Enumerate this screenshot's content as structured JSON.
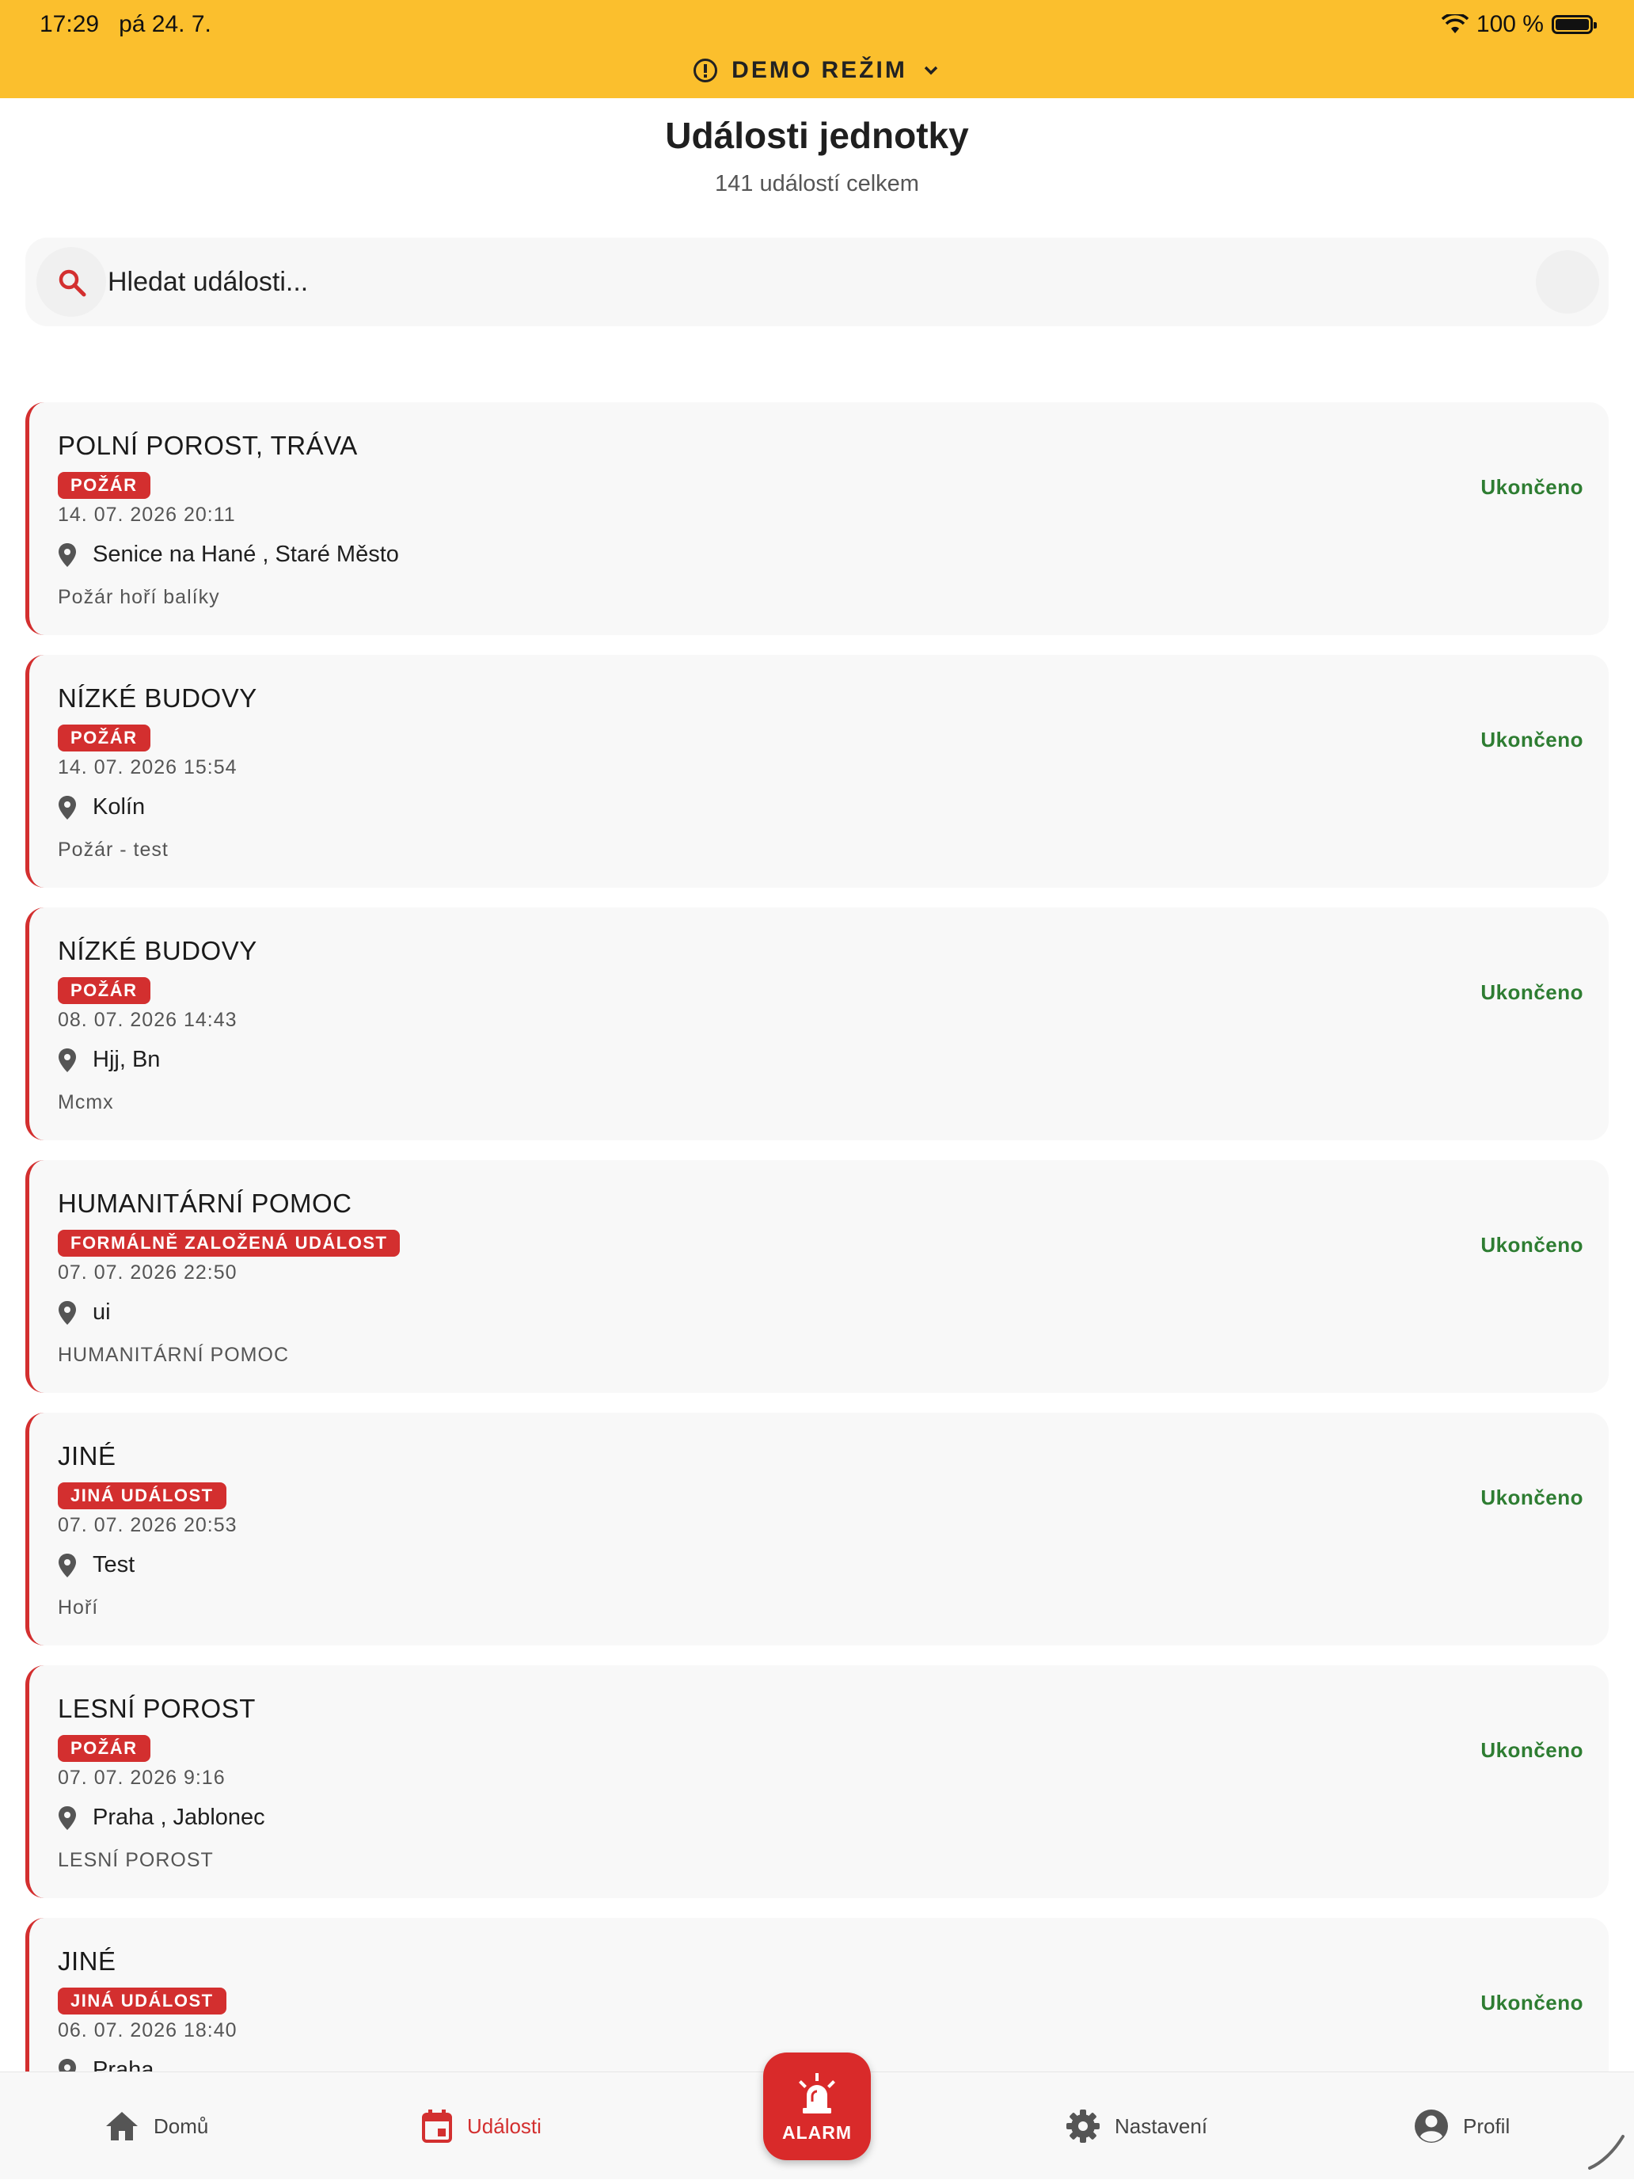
{
  "status_bar": {
    "time": "17:29",
    "date": "pá 24. 7.",
    "battery": "100 %"
  },
  "demo": {
    "label": "DEMO REŽIM"
  },
  "header": {
    "title": "Události jednotky",
    "subtitle": "141 událostí celkem"
  },
  "search": {
    "placeholder": "Hledat události..."
  },
  "events": [
    {
      "title": "POLNÍ POROST, TRÁVA",
      "tag": "POŽÁR",
      "date": "14. 07. 2026 20:11",
      "location": "Senice na Hané , Staré Město",
      "description": "Požár hoří balíky",
      "status": "Ukončeno"
    },
    {
      "title": "NÍZKÉ BUDOVY",
      "tag": "POŽÁR",
      "date": "14. 07. 2026 15:54",
      "location": "Kolín",
      "description": "Požár - test",
      "status": "Ukončeno"
    },
    {
      "title": "NÍZKÉ BUDOVY",
      "tag": "POŽÁR",
      "date": "08. 07. 2026 14:43",
      "location": "Hjj, Bn",
      "description": "Mcmx",
      "status": "Ukončeno"
    },
    {
      "title": "HUMANITÁRNÍ POMOC",
      "tag": "FORMÁLNĚ ZALOŽENÁ UDÁLOST",
      "date": "07. 07. 2026 22:50",
      "location": "ui",
      "description": "HUMANITÁRNÍ POMOC",
      "status": "Ukončeno"
    },
    {
      "title": "JINÉ",
      "tag": "JINÁ UDÁLOST",
      "date": "07. 07. 2026 20:53",
      "location": "Test",
      "description": "Hoří",
      "status": "Ukončeno"
    },
    {
      "title": "LESNÍ POROST",
      "tag": "POŽÁR",
      "date": "07. 07. 2026 9:16",
      "location": "Praha , Jablonec",
      "description": "LESNÍ POROST",
      "status": "Ukončeno"
    },
    {
      "title": "JINÉ",
      "tag": "JINÁ UDÁLOST",
      "date": "06. 07. 2026 18:40",
      "location": "Praha",
      "description": "",
      "status": "Ukončeno"
    }
  ],
  "nav": {
    "home": "Domů",
    "events": "Události",
    "alarm": "ALARM",
    "settings": "Nastavení",
    "profile": "Profil"
  },
  "colors": {
    "accent": "#d32f2f",
    "demo_bar": "#fbbf2d",
    "status_done": "#2e7d32"
  }
}
